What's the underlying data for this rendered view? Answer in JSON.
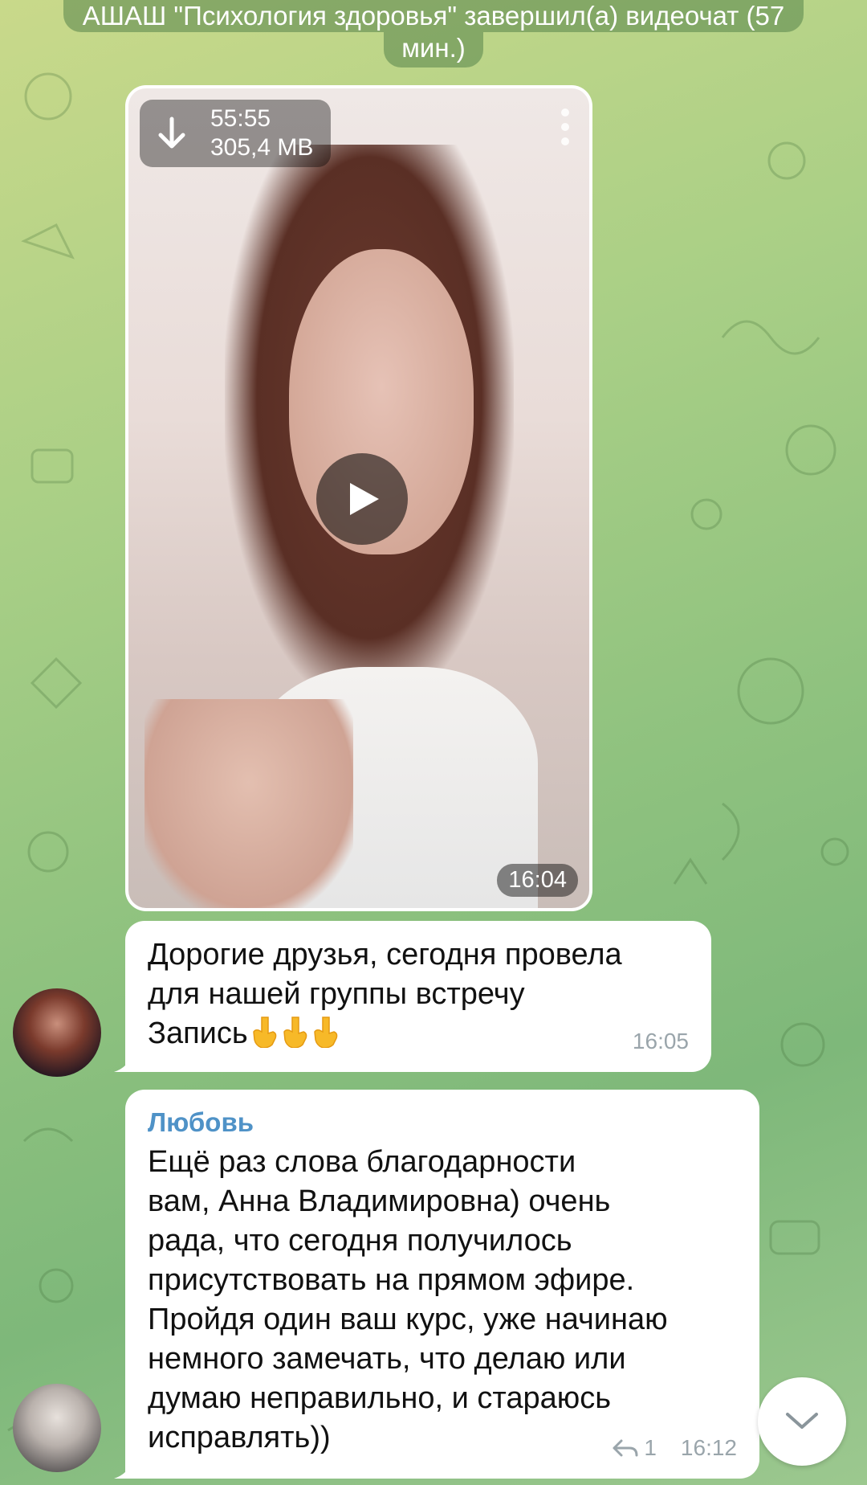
{
  "service_message": {
    "line1": "АШАШ \"Психология здоровья\" завершил(а) видеочат (57",
    "line2": "мин.)"
  },
  "video_message": {
    "duration": "55:55",
    "size": "305,4 MB",
    "time": "16:04"
  },
  "message1": {
    "text": "Дорогие друзья, сегодня провела\nдля нашей группы встречу\nЗапись",
    "time": "16:05"
  },
  "message2": {
    "sender": "Любовь",
    "text": "Ещё раз слова благодарности\nвам, Анна Владимировна) очень\nрада, что сегодня получилось\nприсутствовать на прямом эфире.\nПройдя один ваш курс, уже начинаю\nнемного замечать, что делаю или\nдумаю неправильно, и стараюсь\nисправлять))",
    "replies": "1",
    "time": "16:12"
  },
  "colors": {
    "sender_name": "#4f92c7",
    "bubble": "#ffffff",
    "meta": "#9aa5ab"
  },
  "icons": [
    "download-arrow-icon",
    "more-vertical-icon",
    "play-icon",
    "reply-icon",
    "chevron-down-icon",
    "pointing-down-emoji"
  ]
}
